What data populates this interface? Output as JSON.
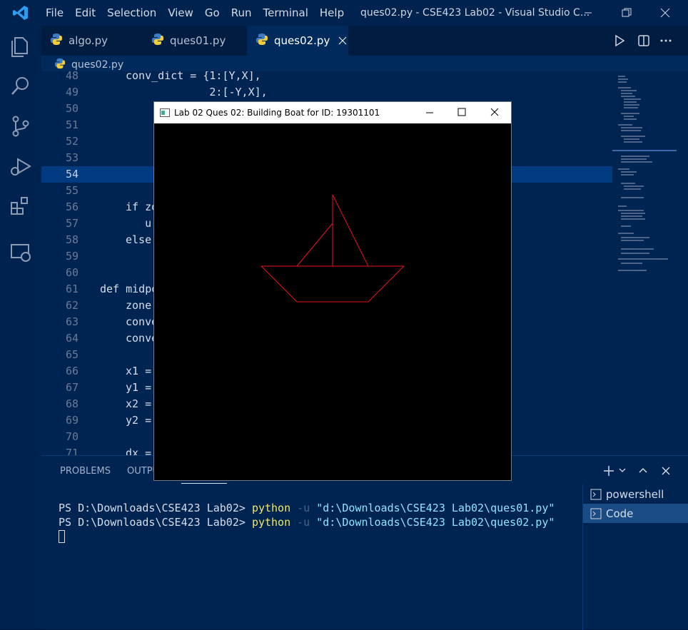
{
  "menu": [
    "File",
    "Edit",
    "Selection",
    "View",
    "Go",
    "Run",
    "Terminal",
    "Help"
  ],
  "window_title": "ques02.py - CSE423 Lab02 - Visual Studio C...",
  "tabs": [
    {
      "label": "algo.py"
    },
    {
      "label": "ques01.py"
    },
    {
      "label": "ques02.py"
    }
  ],
  "breadcrumb": "ques02.py",
  "editor": {
    "lines": [
      {
        "num": "48",
        "code": "conv_dict = {1:[Y,X],"
      },
      {
        "num": "49",
        "code": "             2:[-Y,X],"
      },
      {
        "num": "50",
        "code": ""
      },
      {
        "num": "51",
        "code": ""
      },
      {
        "num": "52",
        "code": ""
      },
      {
        "num": "53",
        "code": ""
      },
      {
        "num": "54",
        "code": ""
      },
      {
        "num": "55",
        "code": ""
      },
      {
        "num": "56",
        "code": "if zo"
      },
      {
        "num": "57",
        "code": "   u"
      },
      {
        "num": "58",
        "code": "else"
      },
      {
        "num": "59",
        "code": ""
      },
      {
        "num": "60",
        "code": ""
      },
      {
        "num": "61",
        "code": "def midpo"
      },
      {
        "num": "62",
        "code": "zone"
      },
      {
        "num": "63",
        "code": "conve"
      },
      {
        "num": "64",
        "code": "conve"
      },
      {
        "num": "65",
        "code": ""
      },
      {
        "num": "66",
        "code": "x1 ="
      },
      {
        "num": "67",
        "code": "y1 ="
      },
      {
        "num": "68",
        "code": "x2 ="
      },
      {
        "num": "69",
        "code": "y2 ="
      },
      {
        "num": "70",
        "code": ""
      },
      {
        "num": "71",
        "code": "dx ="
      }
    ]
  },
  "panel": {
    "tabs": [
      "PROBLEMS",
      "OUTPU"
    ],
    "terminal": [
      {
        "prompt": "PS D:\\Downloads\\CSE423 Lab02> ",
        "cmd": "python",
        "flag": " -u ",
        "arg": "\"d:\\Downloads\\CSE423 Lab02\\ques01.py\""
      },
      {
        "prompt": "PS D:\\Downloads\\CSE423 Lab02> ",
        "cmd": "python",
        "flag": " -u ",
        "arg": "\"d:\\Downloads\\CSE423 Lab02\\ques02.py\""
      }
    ],
    "terminal_list": [
      "powershell",
      "Code"
    ]
  },
  "tk_window": {
    "title": "Lab 02 Ques 02: Building Boat for ID: 19301101",
    "line_color": "#e8141c",
    "boat_segments": [
      [
        150,
        200,
        350,
        200
      ],
      [
        150,
        200,
        200,
        250
      ],
      [
        350,
        200,
        300,
        250
      ],
      [
        200,
        250,
        300,
        250
      ],
      [
        250,
        200,
        250,
        100
      ],
      [
        250,
        100,
        300,
        200
      ],
      [
        200,
        200,
        250,
        140
      ]
    ]
  },
  "colors": {
    "background": "#011a3a",
    "editor_bg": "#002451",
    "accent": "#3794ff"
  }
}
